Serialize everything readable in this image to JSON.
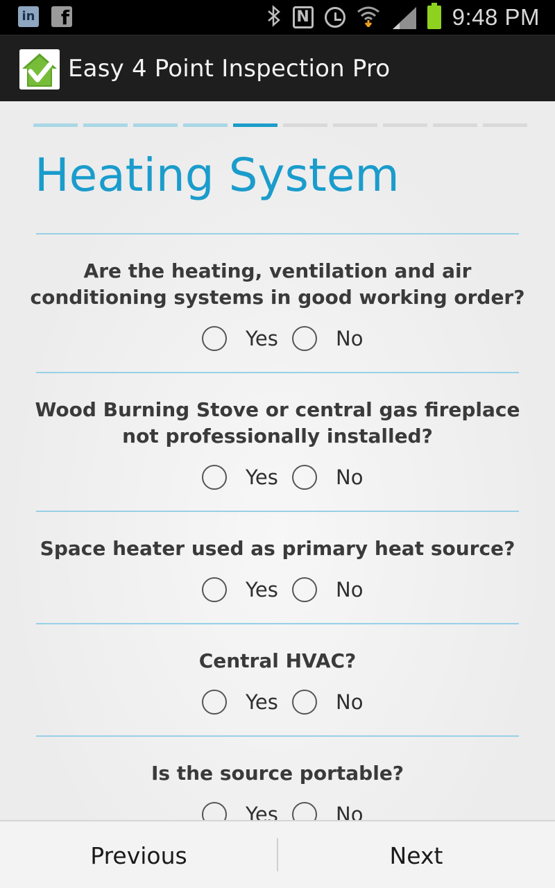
{
  "status_bar": {
    "left_icons": [
      {
        "name": "linkedin-icon",
        "glyph": "in"
      },
      {
        "name": "facebook-icon",
        "glyph": "f"
      }
    ],
    "time": "9:48 PM",
    "battery_color": "#8fd11f"
  },
  "app": {
    "title": "Easy 4 Point Inspection Pro",
    "logo_icon": "house-check-icon"
  },
  "progress": {
    "total_steps": 10,
    "current_step": 5
  },
  "section": {
    "title": "Heating System",
    "accent_color": "#1a9ccc"
  },
  "questions": [
    {
      "text": "Are the heating, ventilation and air conditioning systems in good working order?",
      "yes_label": "Yes",
      "no_label": "No"
    },
    {
      "text": "Wood Burning Stove or central gas fireplace not professionally installed?",
      "yes_label": "Yes",
      "no_label": "No"
    },
    {
      "text": "Space heater used as primary heat source?",
      "yes_label": "Yes",
      "no_label": "No"
    },
    {
      "text": "Central HVAC?",
      "yes_label": "Yes",
      "no_label": "No"
    },
    {
      "text": "Is the source portable?",
      "yes_label": "Yes",
      "no_label": "No"
    }
  ],
  "navigation": {
    "previous_label": "Previous",
    "next_label": "Next"
  }
}
